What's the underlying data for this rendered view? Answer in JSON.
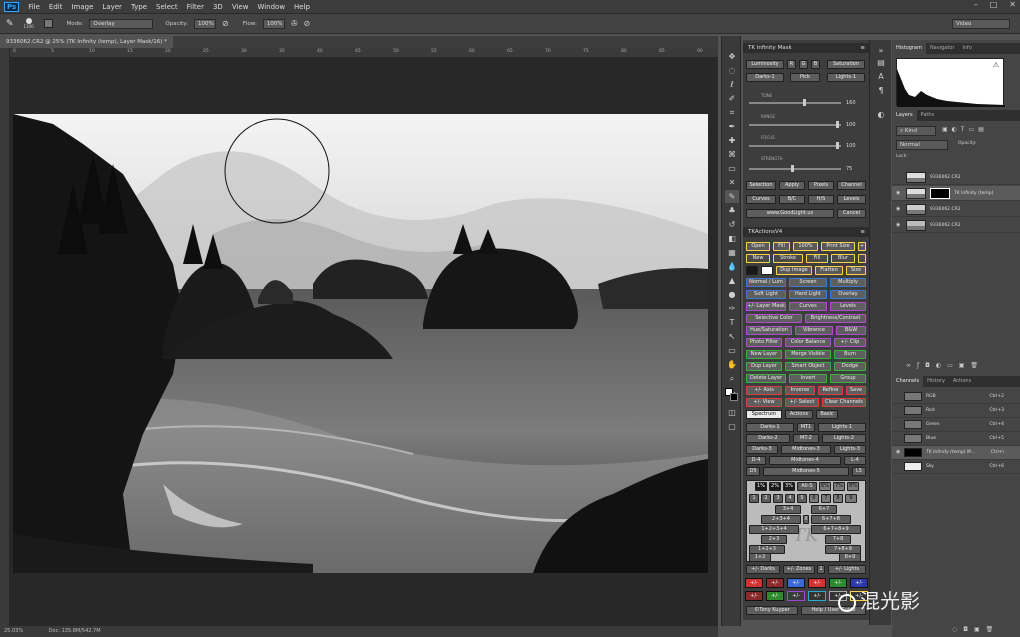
{
  "app": {
    "logo": "Ps"
  },
  "menu": [
    "File",
    "Edit",
    "Image",
    "Layer",
    "Type",
    "Select",
    "Filter",
    "3D",
    "View",
    "Window",
    "Help"
  ],
  "options": {
    "brush_size": "1100",
    "mode_label": "Mode:",
    "mode_value": "Overlay",
    "opacity_label": "Opacity:",
    "opacity_value": "100%",
    "flow_label": "Flow:",
    "flow_value": "100%",
    "workspace": "Video"
  },
  "document": {
    "tab_title": "9336062.CR2 @ 25% (TK Infinity (temp), Layer Mask/16) *",
    "status_zoom": "25.03%",
    "status_doc": "Doc: 135.8M/542.7M"
  },
  "ruler_ticks": [
    "0",
    "5",
    "10",
    "15",
    "20",
    "25",
    "30",
    "35",
    "40",
    "45",
    "50",
    "55",
    "60",
    "65",
    "70",
    "75",
    "80",
    "85",
    "90"
  ],
  "tk": {
    "title": "TK Infinity Mask",
    "row1": [
      "Luminosity",
      "R",
      "G",
      "B",
      "Saturation"
    ],
    "row2": [
      "Darks-1",
      "Pick",
      "Lights-1"
    ],
    "sliders": [
      {
        "label": "TONE",
        "value": "160"
      },
      {
        "label": "RANGE",
        "value": "100"
      },
      {
        "label": "FOCUS",
        "value": "100"
      },
      {
        "label": "STRENGTH",
        "value": "75"
      }
    ],
    "actions_a": [
      "Selection",
      "Apply",
      "Pixels",
      "Channel"
    ],
    "actions_b": [
      "Curves",
      "B/C",
      "H/S",
      "Levels"
    ],
    "website": "www.GoodLight.us",
    "cancel": "Cancel",
    "v4_title": "TKActionsV4",
    "v4_rows": [
      [
        "Open",
        "Fill",
        "100%",
        "Print Size",
        "+"
      ],
      [
        "New",
        "Stroke",
        "Fill",
        "Blur"
      ],
      [
        "Dup Image",
        "Flatten",
        "Size"
      ],
      [
        "Normal / Lum",
        "Screen",
        "Multiply"
      ],
      [
        "Soft Light",
        "Hard Light",
        "Overlay"
      ],
      [
        "+/- Layer Mask",
        "Curves",
        "Levels"
      ],
      [
        "Selective Color",
        "Brightness/Contrast"
      ],
      [
        "Hue/Saturation",
        "Vibrance",
        "B&W"
      ],
      [
        "Photo Filter",
        "Color Balance",
        "+/- Clip"
      ],
      [
        "New Layer",
        "Merge Visible",
        "Burn"
      ],
      [
        "Dup Layer",
        "Smart Object",
        "Dodge"
      ],
      [
        "Delete Layer",
        "Invert",
        "Group"
      ],
      [
        "+/- Axis",
        "Inverse",
        "Refine",
        "Save"
      ],
      [
        "+/- View",
        "+/- Select",
        "Clear Channels"
      ]
    ],
    "tabs3": [
      "Spectrum",
      "Actions",
      "Basic"
    ],
    "spectrum_rows": [
      [
        "Darks-1",
        "MT1",
        "Lights-1"
      ],
      [
        "Darks-2",
        "MT-2",
        "Lights-2"
      ],
      [
        "Darks-3",
        "Midtones-3",
        "Lights-3"
      ],
      [
        "D-4",
        "Midtones-4",
        "L-4"
      ],
      [
        "D5",
        "Midtones-5",
        "L5"
      ]
    ],
    "pct_row": [
      "1%",
      "2%",
      "3%",
      "All-S",
      "6%",
      "7%",
      "8%"
    ],
    "zones_row": [
      "1",
      "2",
      "3",
      "4",
      "5",
      "6",
      "7",
      "8",
      "9"
    ],
    "zone_combos": [
      "3+4",
      "6+7",
      "2+3+4",
      "X",
      "6+7+8",
      "1+2+3+4",
      "6+7+8+9",
      "2+3",
      "7+8",
      "1+2+3",
      "7+8+9",
      "1+2",
      "8+9"
    ],
    "zones_bar": [
      "+/- Darks",
      "+/- Zones",
      "1",
      "+/- Lights"
    ],
    "small_btns": [
      "+/-",
      "+/-",
      "+/-",
      "+/-",
      "+/-",
      "+/-",
      "+/-",
      "+/-",
      "+/-",
      "+/-",
      "+/-",
      "+/-"
    ],
    "credit": "©Tony Kuyper",
    "help": "Help / User Guide",
    "watermark_logo": "TK"
  },
  "right": {
    "tabs_top": [
      "Histogram",
      "Navigator",
      "Info"
    ],
    "tabs_layers": [
      "Layers",
      "Paths"
    ],
    "kind": "Kind",
    "blend": "Normal",
    "opacity": "Opacity:",
    "lock": "Lock:",
    "layers": [
      {
        "name": "9336062.CR2",
        "sel": false
      },
      {
        "name": "TK Infinity (temp)",
        "sel": true
      },
      {
        "name": "9336062.CR2",
        "sel": false
      },
      {
        "name": "9336062.CR2",
        "sel": false
      }
    ],
    "tabs_channels": [
      "Channels",
      "History",
      "Actions"
    ],
    "channels": [
      {
        "name": "RGB",
        "key": "Ctrl+2"
      },
      {
        "name": "Red",
        "key": "Ctrl+3"
      },
      {
        "name": "Green",
        "key": "Ctrl+4"
      },
      {
        "name": "Blue",
        "key": "Ctrl+5"
      },
      {
        "name": "TK Infinity (temp) M...",
        "key": "Ctrl+\\"
      },
      {
        "name": "Sky",
        "key": "Ctrl+6"
      }
    ]
  },
  "watermark_text": "混光影"
}
